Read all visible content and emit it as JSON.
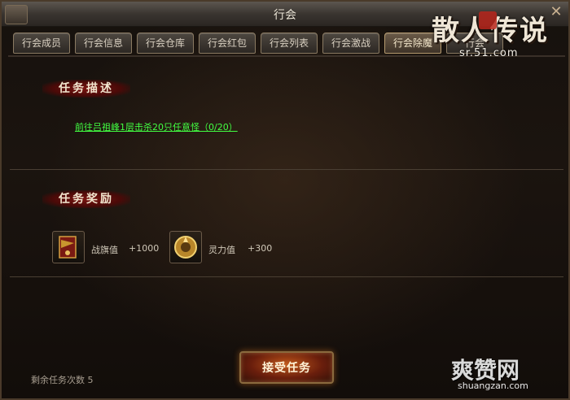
{
  "window": {
    "title": "行会"
  },
  "tabs": [
    {
      "label": "行会成员"
    },
    {
      "label": "行会信息"
    },
    {
      "label": "行会仓库"
    },
    {
      "label": "行会红包"
    },
    {
      "label": "行会列表"
    },
    {
      "label": "行会激战"
    },
    {
      "label": "行会除魔",
      "active": true
    },
    {
      "label": "行会"
    }
  ],
  "logo": {
    "title": "散人传说",
    "url": "sr.51.com"
  },
  "task": {
    "description_header": "任务描述",
    "description": "前往吕祖峰1层击杀20只任意怪（0/20）",
    "reward_header": "任务奖励",
    "rewards": [
      {
        "label": "战旗值",
        "value": "+1000",
        "icon": "war-banner-icon"
      },
      {
        "label": "灵力值",
        "value": "+300",
        "icon": "spirit-orb-icon"
      }
    ],
    "accept_label": "接受任务",
    "remaining_text": "剩余任务次数 5"
  },
  "watermark": {
    "brand": "爽赞网",
    "url": "shuangzan.com"
  },
  "colors": {
    "task_link": "#42ff42",
    "section_header": "#7a1410",
    "accept_button": "#c25a1c"
  }
}
